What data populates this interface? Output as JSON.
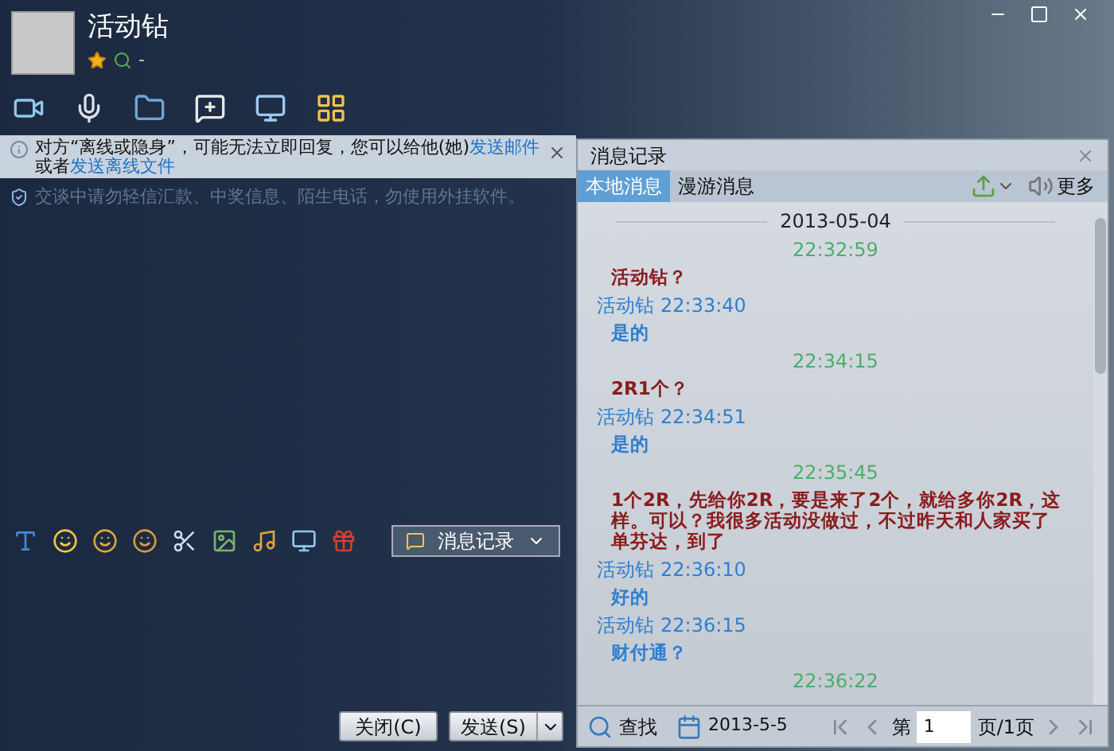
{
  "window": {
    "title": "活动钻",
    "status": "-"
  },
  "notice": {
    "text": "对方“离线或隐身”，可能无法立即回复，您可以给他(她)",
    "link1": "发送邮件",
    "middle": "或者",
    "link2": "发送离线文件"
  },
  "security": "交谈中请勿轻信汇款、中奖信息、陌生电话，勿使用外挂软件。",
  "history_button": "消息记录",
  "buttons": [
    {
      "label": "关闭(C)",
      "kind": "plain"
    },
    {
      "label": "发送(S)",
      "kind": "split"
    }
  ],
  "panel": {
    "title": "消息记录",
    "tabs": [
      {
        "label": "本地消息",
        "selected": true
      },
      {
        "label": "漫游消息",
        "selected": false
      }
    ],
    "more": "更多",
    "messages": [
      {
        "kind": "date",
        "text": "2013-05-04"
      },
      {
        "kind": "time",
        "text": "22:32:59"
      },
      {
        "kind": "text",
        "text": "活动钻？",
        "color": "#8b1c1c"
      },
      {
        "kind": "sender",
        "name": "活动钻",
        "text": "22:33:40"
      },
      {
        "kind": "text",
        "text": "是的",
        "color": "#2f7fd0"
      },
      {
        "kind": "time",
        "text": "22:34:15"
      },
      {
        "kind": "text",
        "text": "2R1个？",
        "color": "#8b1c1c"
      },
      {
        "kind": "sender",
        "name": "活动钻",
        "text": "22:34:51"
      },
      {
        "kind": "text",
        "text": "是的",
        "color": "#2f7fd0"
      },
      {
        "kind": "time",
        "text": "22:35:45"
      },
      {
        "kind": "text",
        "text": "1个2R，先给你2R，要是来了2个，就给多你2R，这样。可以？我很多活动没做过，不过昨天和人家买了单芬达，到了",
        "color": "#8b1c1c"
      },
      {
        "kind": "sender",
        "name": "活动钻",
        "text": "22:36:10"
      },
      {
        "kind": "text",
        "text": "好的",
        "color": "#2f7fd0"
      },
      {
        "kind": "sender",
        "name": "活动钻",
        "text": "22:36:15"
      },
      {
        "kind": "text",
        "text": "财付通？",
        "color": "#2f7fd0"
      },
      {
        "kind": "time",
        "text": "22:36:22"
      }
    ],
    "search": "查找",
    "date": "2013-5-5",
    "page_prefix": "第",
    "page": "1",
    "page_suffix": "页/1页"
  }
}
